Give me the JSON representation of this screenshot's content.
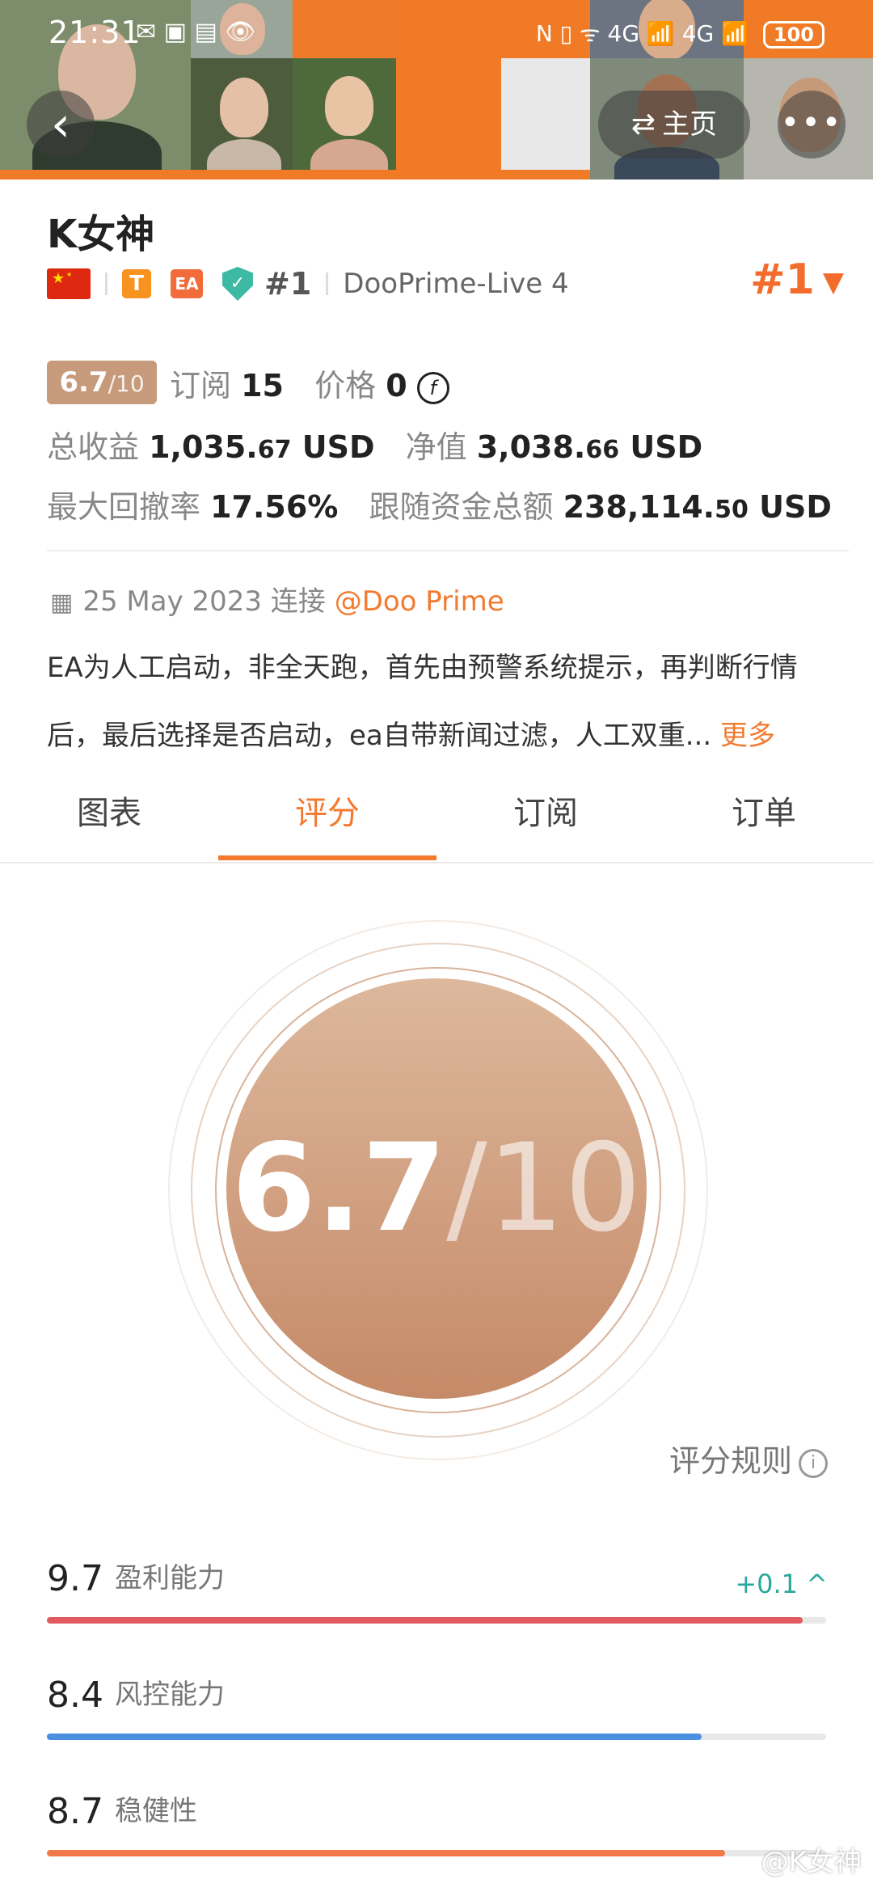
{
  "status_bar": {
    "time": "21:31",
    "icons_left": "✉ ▣ ▤ 👁",
    "icons_right": "N ▯ ᯤ 4G 📶 4G 📶",
    "battery": "100"
  },
  "header": {
    "back_icon": "chevron-left-icon",
    "home_label": "主页",
    "home_icon": "swap-arrows-icon",
    "more_icon": "more-dots-icon",
    "accent_color": "#f07a25"
  },
  "profile": {
    "name": "K女神",
    "badge_t": "T",
    "badge_ea": "EA",
    "shield_check": "✓",
    "rank_small": "#1",
    "server": "DooPrime-Live 4",
    "rank_big": "#1",
    "rank_caret": "▼"
  },
  "stats": {
    "score_main": "6.7",
    "score_den": "/10",
    "subs_label": "订阅",
    "subs_value": "15",
    "price_label": "价格",
    "price_value": "0",
    "coin_symbol": "f",
    "total_profit_label": "总收益",
    "total_profit_int": "1,035.",
    "total_profit_dec": "67",
    "total_profit_unit": "USD",
    "equity_label": "净值",
    "equity_int": "3,038.",
    "equity_dec": "66",
    "equity_unit": "USD",
    "drawdown_label": "最大回撤率",
    "drawdown_value": "17.56%",
    "follow_label": "跟随资金总额",
    "follow_int": "238,114.",
    "follow_dec": "50",
    "follow_unit": "USD"
  },
  "connection": {
    "date": "25 May 2023 连接",
    "broker": "@Doo Prime"
  },
  "description": {
    "line1": "EA为人工启动，非全天跑，首先由预警系统提示，再判断行情",
    "line2": "后，最后选择是否启动，ea自带新闻过滤，人工双重...",
    "more": "更多"
  },
  "tabs": [
    {
      "label": "图表"
    },
    {
      "label": "评分"
    },
    {
      "label": "订阅"
    },
    {
      "label": "订单"
    }
  ],
  "score_circle": {
    "main": "6.7",
    "den": "/10",
    "rules_label": "评分规则",
    "info_icon": "i"
  },
  "metrics": [
    {
      "value": "9.7",
      "name": "盈利能力",
      "fraction": 0.97,
      "color": "#e05a5f",
      "delta": "+0.1 ^"
    },
    {
      "value": "8.4",
      "name": "风控能力",
      "fraction": 0.84,
      "color": "#4a8fe0"
    },
    {
      "value": "8.7",
      "name": "稳健性",
      "fraction": 0.87,
      "color": "#f0784a"
    }
  ],
  "watermark": "@K女神"
}
